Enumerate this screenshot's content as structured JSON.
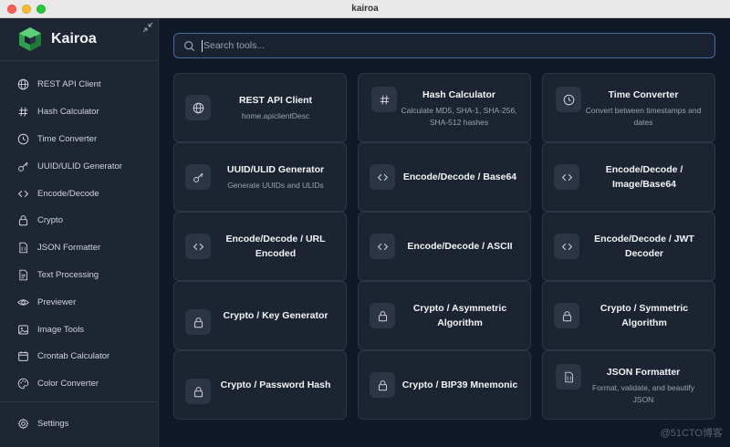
{
  "window": {
    "title": "kairoa"
  },
  "brand": {
    "name": "Kairoa"
  },
  "sidebar": {
    "items": [
      {
        "label": "REST API Client",
        "icon": "globe-icon"
      },
      {
        "label": "Hash Calculator",
        "icon": "hash-icon"
      },
      {
        "label": "Time Converter",
        "icon": "clock-icon"
      },
      {
        "label": "UUID/ULID Generator",
        "icon": "key-icon"
      },
      {
        "label": "Encode/Decode",
        "icon": "code-icon"
      },
      {
        "label": "Crypto",
        "icon": "lock-icon"
      },
      {
        "label": "JSON Formatter",
        "icon": "file-json-icon"
      },
      {
        "label": "Text Processing",
        "icon": "file-text-icon"
      },
      {
        "label": "Previewer",
        "icon": "eye-icon"
      },
      {
        "label": "Image Tools",
        "icon": "image-icon"
      },
      {
        "label": "Crontab Calculator",
        "icon": "calendar-icon"
      },
      {
        "label": "Color Converter",
        "icon": "palette-icon"
      }
    ],
    "settings": {
      "label": "Settings",
      "icon": "gear-icon"
    }
  },
  "search": {
    "placeholder": "Search tools..."
  },
  "cards": [
    {
      "title": "REST API Client",
      "desc": "home.apiclientDesc",
      "icon": "globe-icon"
    },
    {
      "title": "Hash Calculator",
      "desc": "Calculate MD5, SHA-1, SHA-256, SHA-512 hashes",
      "icon": "hash-icon"
    },
    {
      "title": "Time Converter",
      "desc": "Convert between timestamps and dates",
      "icon": "clock-icon"
    },
    {
      "title": "UUID/ULID Generator",
      "desc": "Generate UUIDs and ULIDs",
      "icon": "key-icon"
    },
    {
      "title": "Encode/Decode / Base64",
      "desc": "",
      "icon": "code-icon"
    },
    {
      "title": "Encode/Decode / Image/Base64",
      "desc": "",
      "icon": "code-icon"
    },
    {
      "title": "Encode/Decode / URL Encoded",
      "desc": "",
      "icon": "code-icon"
    },
    {
      "title": "Encode/Decode / ASCII",
      "desc": "",
      "icon": "code-icon"
    },
    {
      "title": "Encode/Decode / JWT Decoder",
      "desc": "",
      "icon": "code-icon"
    },
    {
      "title": "Crypto / Key Generator",
      "desc": "",
      "icon": "lock-icon"
    },
    {
      "title": "Crypto / Asymmetric Algorithm",
      "desc": "",
      "icon": "lock-icon"
    },
    {
      "title": "Crypto / Symmetric Algorithm",
      "desc": "",
      "icon": "lock-icon"
    },
    {
      "title": "Crypto / Password Hash",
      "desc": "",
      "icon": "lock-icon"
    },
    {
      "title": "Crypto / BIP39 Mnemonic",
      "desc": "",
      "icon": "lock-icon"
    },
    {
      "title": "JSON Formatter",
      "desc": "Format, validate, and beautify JSON",
      "icon": "file-json-icon"
    }
  ],
  "watermark": "@51CTO博客",
  "colors": {
    "background": "#111827",
    "sidebar": "#1e2533",
    "card": "#1c2331",
    "accent_border": "#4b6a9b",
    "logo_green": "#3fb950"
  }
}
